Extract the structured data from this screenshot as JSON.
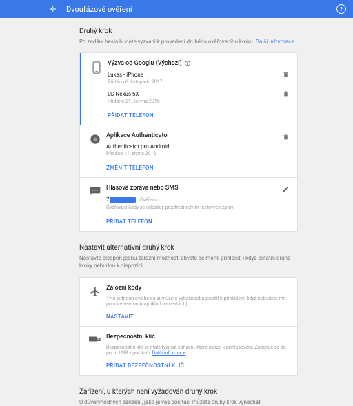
{
  "header": {
    "title": "Dvoufázové ověření"
  },
  "section1": {
    "title": "Druhý krok",
    "desc": "Po zadání hesla budete vyzváni k provedení druhého ověřovacího kroku.",
    "moreInfo": "Další informace"
  },
  "prompt": {
    "title": "Výzva od Googlu (Výchozí)",
    "devices": [
      {
        "name": "Lukas - iPhone",
        "added": "Přidáno 6. listopadu 2017"
      },
      {
        "name": "LG Nexus 5X",
        "added": "Přidáno 21. června 2016"
      }
    ],
    "action": "PŘIDAT TELEFON"
  },
  "authenticator": {
    "title": "Aplikace Authenticator",
    "sub": "Authenticator pro Android",
    "added": "Přidáno 11. srpna 2016",
    "action": "ZMĚNIT TELEFON"
  },
  "sms": {
    "title": "Hlasová zpráva nebo SMS",
    "numberPrefix": "7",
    "verified": "Ověřeno",
    "desc": "Ověřovací kódy se odesílají prostřednictvím textových zpráv.",
    "action": "PŘIDAT TELEFON"
  },
  "section2": {
    "title": "Nastavit alternativní druhý krok",
    "desc": "Nastavte alespoň jednu záložní možnost, abyste se mohli přihlásit, i když ostatní druhé kroky nebudou k dispozici."
  },
  "backup": {
    "title": "Záložní kódy",
    "desc": "Tyto jednorázová hesla si můžete vytisknout a použít k přihlášení, když nebudete mít po ruce telefon (například na cestách).",
    "action": "NASTAVIT"
  },
  "key": {
    "title": "Bezpečnostní klíč",
    "desc": "Bezpečnostní klíč je malé fyzické zařízení, které slouží k přihlašování. Zapojuje se do portu USB v počítači.",
    "moreInfo": "Další informace",
    "action": "PŘIDAT BEZPEČNOSTNÍ KLÍČ"
  },
  "section3": {
    "title": "Zařízení, u kterých není vyžadován druhý krok",
    "desc": "U důvěryhodných zařízení, jako je váš počítač, můžete druhý krok vynechat."
  }
}
